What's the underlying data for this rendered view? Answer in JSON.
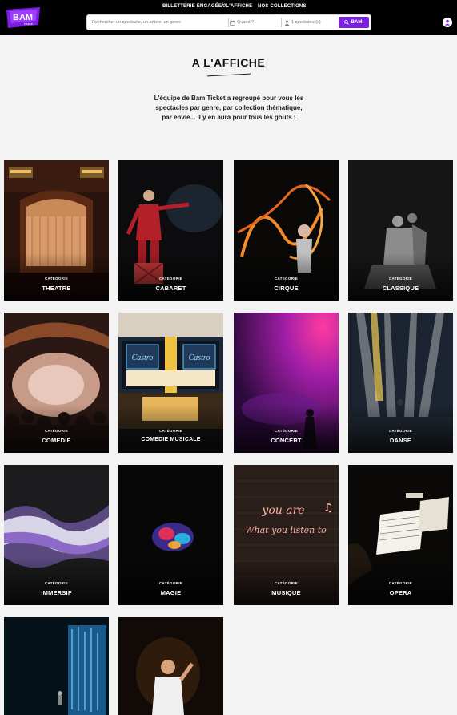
{
  "header": {
    "logo_text": "BAM",
    "logo_sub": "TICKET",
    "nav": [
      "BILLETTERIE ENGAGÉE ?",
      "À L'AFFICHE",
      "NOS COLLECTIONS"
    ],
    "search": {
      "query_placeholder": "Rechercher un spectacle, un artiste, un genre",
      "date_placeholder": "Quand ?",
      "spectators_value": "1 spectateur(s)",
      "button_label": "BAM!"
    }
  },
  "main": {
    "title": "A L'AFFICHE",
    "intro": "L'équipe de Bam Ticket a regroupé pour vous les spectacles par genre, par collection thématique, par envie... Il y en aura pour tous les goûts !"
  },
  "categories": [
    {
      "label": "CATÉGORIE",
      "name": "THEATRE"
    },
    {
      "label": "CATÉGORIE",
      "name": "CABARET"
    },
    {
      "label": "CATÉGORIE",
      "name": "CIRQUE"
    },
    {
      "label": "CATÉGORIE",
      "name": "CLASSIQUE"
    },
    {
      "label": "CATÉGORIE",
      "name": "COMEDIE"
    },
    {
      "label": "CATÉGORIE",
      "name": "COMEDIE MUSICALE"
    },
    {
      "label": "CATÉGORIE",
      "name": "CONCERT"
    },
    {
      "label": "CATÉGORIE",
      "name": "DANSE"
    },
    {
      "label": "CATÉGORIE",
      "name": "IMMERSIF"
    },
    {
      "label": "CATÉGORIE",
      "name": "MAGIE"
    },
    {
      "label": "CATÉGORIE",
      "name": "MUSIQUE"
    },
    {
      "label": "CATÉGORIE",
      "name": "OPERA"
    },
    {
      "label": "",
      "name": ""
    },
    {
      "label": "",
      "name": ""
    }
  ],
  "neon": {
    "line1": "you are",
    "line2": "What you listen to"
  },
  "marquee": {
    "left": "Castro",
    "right": "Castro"
  },
  "colors": {
    "accent": "#7b1fe0",
    "header_bg": "#000000",
    "page_bg": "#f3f3f3"
  }
}
